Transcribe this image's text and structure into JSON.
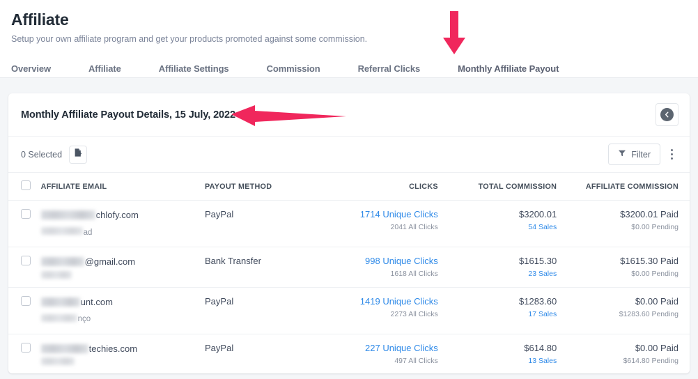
{
  "header": {
    "title": "Affiliate",
    "subtitle": "Setup your own affiliate program and get your products promoted against some commission.",
    "tabs": [
      {
        "label": "Overview",
        "active": false
      },
      {
        "label": "Affiliate",
        "active": false
      },
      {
        "label": "Affiliate Settings",
        "active": false
      },
      {
        "label": "Commission",
        "active": false
      },
      {
        "label": "Referral Clicks",
        "active": false
      },
      {
        "label": "Monthly Affiliate Payout",
        "active": true
      }
    ]
  },
  "card": {
    "title": "Monthly Affiliate Payout Details, 15 July, 2022",
    "back_button_icon": "chevron-left-icon"
  },
  "toolbar": {
    "selected_label": "0 Selected",
    "export_icon": "export-document-icon",
    "filter_label": "Filter",
    "filter_icon": "funnel-icon",
    "more_icon": "kebab-menu-icon"
  },
  "table": {
    "columns": [
      "AFFILIATE EMAIL",
      "PAYOUT METHOD",
      "CLICKS",
      "TOTAL COMMISSION",
      "AFFILIATE COMMISSION"
    ],
    "rows": [
      {
        "email_redacted": true,
        "email_visible": "chlofy.com",
        "email_sub_visible": "ad",
        "payout_method": "PayPal",
        "unique_clicks": "1714 Unique Clicks",
        "all_clicks": "2041 All Clicks",
        "total_commission": "$3200.01",
        "sales": "54 Sales",
        "paid": "$3200.01 Paid",
        "pending": "$0.00 Pending"
      },
      {
        "email_redacted": true,
        "email_visible": "@gmail.com",
        "email_sub_visible": "",
        "payout_method": "Bank Transfer",
        "unique_clicks": "998 Unique Clicks",
        "all_clicks": "1618 All Clicks",
        "total_commission": "$1615.30",
        "sales": "23 Sales",
        "paid": "$1615.30 Paid",
        "pending": "$0.00 Pending"
      },
      {
        "email_redacted": true,
        "email_visible": "unt.com",
        "email_sub_visible": "nço",
        "payout_method": "PayPal",
        "unique_clicks": "1419 Unique Clicks",
        "all_clicks": "2273 All Clicks",
        "total_commission": "$1283.60",
        "sales": "17 Sales",
        "paid": "$0.00 Paid",
        "pending": "$1283.60 Pending"
      },
      {
        "email_redacted": true,
        "email_visible": "techies.com",
        "email_sub_visible": "",
        "payout_method": "PayPal",
        "unique_clicks": "227 Unique Clicks",
        "all_clicks": "497 All Clicks",
        "total_commission": "$614.80",
        "sales": "13 Sales",
        "paid": "$0.00 Paid",
        "pending": "$614.80 Pending"
      }
    ]
  },
  "annotations": [
    {
      "name": "arrow-down-to-monthly-affiliate-payout-tab",
      "direction": "down",
      "color": "#f0275c"
    },
    {
      "name": "arrow-left-to-card-title",
      "direction": "left",
      "color": "#f0275c"
    }
  ],
  "colors": {
    "accent_link": "#2f8ae8",
    "annotation": "#f0275c",
    "page_bg": "#f4f6f8",
    "text_dark": "#212b36",
    "text_muted": "#8a919e"
  }
}
